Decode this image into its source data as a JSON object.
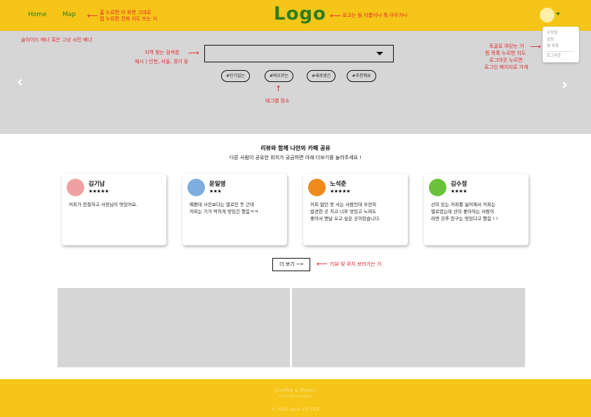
{
  "header": {
    "nav": [
      {
        "label": "Home"
      },
      {
        "label": "Map"
      }
    ],
    "logo": "Logo"
  },
  "user_menu": {
    "items": [
      "수정됨",
      "설정",
      "찜 목록"
    ],
    "logout": "로그아웃"
  },
  "search": {
    "value": ""
  },
  "tags": [
    "#인기있는",
    "#따오르는",
    "#새로생긴",
    "#추천해요"
  ],
  "annotations": {
    "nav_note_1": "홈 누르면 이 화면 그대로",
    "nav_note_2": "맵 누르면 전체 지도 뜨는 거",
    "logo_note": "로고는 팀 이름이나 뭐 아무거나",
    "banner_note": "슬라이드 배너 혹은 그냥 사진 배너",
    "search_note_1": "지역 찾는 검색창",
    "search_note_2": "예시 ) 인천, 서울, 경기 등",
    "tag_note": "태그별 장소",
    "menu_note_1": "토글로 여닫는 거",
    "menu_note_2": "찜 목록 누르면 지도",
    "menu_note_3": "로그아웃 누르면",
    "menu_note_4": "로그인 페이지로 가게",
    "more_note": "리뷰 및 위치 보러가는 거"
  },
  "reviews": {
    "title": "리뷰와 함께 나만의 카페 공유",
    "subtitle": "다른 사람이 공유한 위치가 궁금하면 아래 더보기를 눌러주세요 !",
    "cards": [
      {
        "name": "김기남",
        "stars": "★★★★★",
        "text": "커피가 친절하고 사장님이 멋있어요.",
        "color": "#f0a0a0"
      },
      {
        "name": "윤일영",
        "stars": "★★★",
        "text": "예쁜데 사진보다는 별로인 듯 근데\n커피는 기가 막히게 맛있긴 했음ㅋㅋ",
        "color": "#7eaee0"
      },
      {
        "name": "노석준",
        "stars": "★★★★★",
        "text": "커피 없인 못 사는 사람인데 우연히\n발견한 곳 치고 너무 맛있고 노래도\n좋아서 맨날 오고 싶은 곳이었습니다.",
        "color": "#ef8a1f"
      },
      {
        "name": "김수정",
        "stars": "★★★★",
        "text": "산미 있는 커피를 싫어해서 커피는\n별로였는데 산미 좋아하는 사람이\n라면 강추 친구는 맛있다고 했음 ! !",
        "color": "#6cc23a"
      }
    ],
    "more_button": "더 보기 ⟶"
  },
  "footer": {
    "line1": "[Coffee & Music]",
    "line2": "mini mini project",
    "line3": "© 2024 Java 5기 10조"
  },
  "colors": {
    "brand_yellow": "#f5c518",
    "brand_green": "#2e7d1f",
    "annotation_red": "#e0282b",
    "placeholder_gray": "#d6d6d6"
  }
}
